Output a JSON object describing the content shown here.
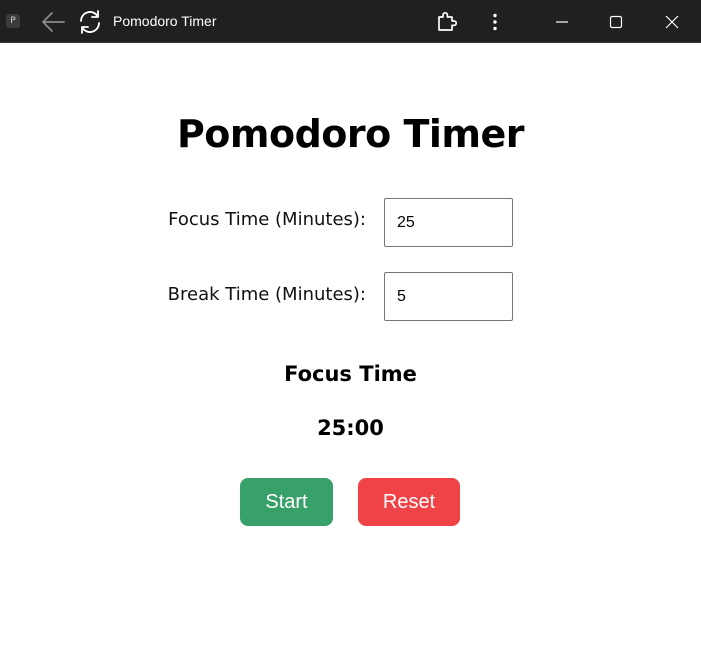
{
  "browser": {
    "favicon_letter": "P",
    "tab_title": "Pomodoro Timer",
    "icons": {
      "back": "back-arrow-icon",
      "reload": "reload-icon",
      "extensions": "puzzle-piece-icon",
      "menu": "more-vertical-icon",
      "minimize": "minimize-icon",
      "maximize": "maximize-icon",
      "close": "close-icon"
    }
  },
  "app": {
    "title": "Pomodoro Timer",
    "focus_label": "Focus Time (Minutes):",
    "focus_value": "25",
    "break_label": "Break Time (Minutes):",
    "break_value": "5",
    "mode_label": "Focus Time",
    "timer_display": "25:00",
    "start_label": "Start",
    "reset_label": "Reset"
  },
  "colors": {
    "start_button": "#38a169",
    "reset_button": "#f04347",
    "titlebar": "#202020"
  }
}
